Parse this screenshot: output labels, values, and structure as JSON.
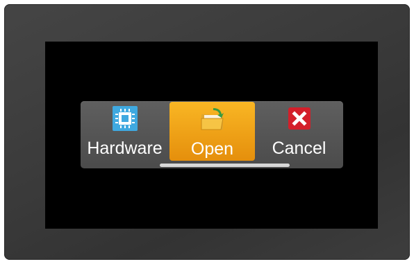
{
  "menu": {
    "items": [
      {
        "label": "Hardware",
        "icon": "chip-icon",
        "selected": false
      },
      {
        "label": "Open",
        "icon": "folder-open-icon",
        "selected": true
      },
      {
        "label": "Cancel",
        "icon": "close-icon",
        "selected": false
      }
    ]
  },
  "colors": {
    "bezel": "#3a3a3a",
    "screen": "#000000",
    "menu_bar": "#555555",
    "selected": "#f2a21a",
    "chip_icon": "#3fa9e0",
    "close_icon": "#d31f2a",
    "folder_icon": "#f6c445",
    "scroll_track": "#d8d8d8"
  }
}
